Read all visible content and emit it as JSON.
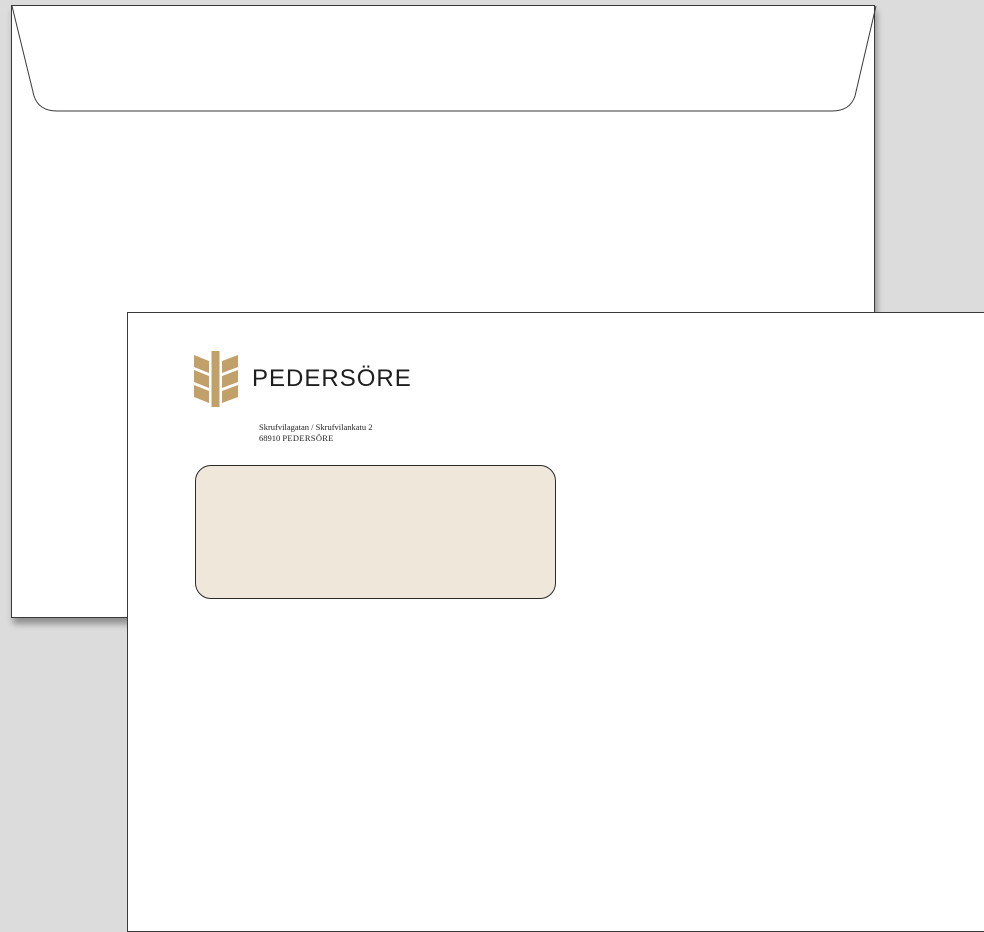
{
  "brand": {
    "name": "PEDERSÖRE",
    "logo_icon": "pedersore-wheat-logo-icon",
    "logo_color": "#c2a06a"
  },
  "address": {
    "street": "Skrufvilagatan / Skrufvilankatu 2",
    "postal_code": "68910",
    "city": "PEDERSÖRE"
  },
  "colors": {
    "background": "#dcdcdc",
    "envelope": "#ffffff",
    "window": "#efe7da"
  }
}
